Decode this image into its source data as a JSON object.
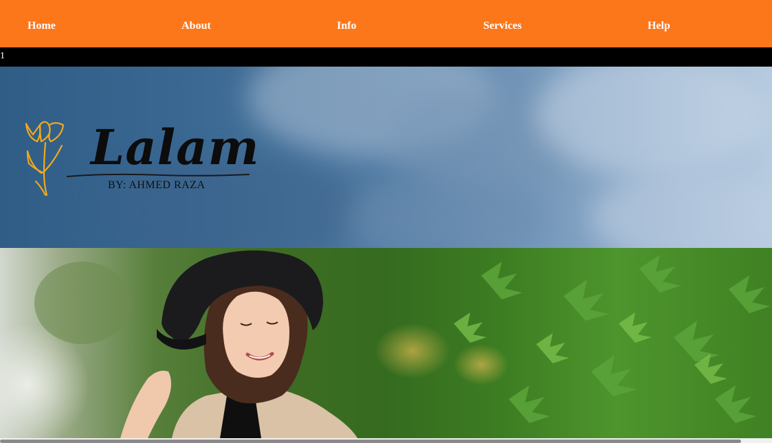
{
  "nav": {
    "items": [
      {
        "label": "Home"
      },
      {
        "label": "About"
      },
      {
        "label": "Info"
      },
      {
        "label": "Services"
      },
      {
        "label": "Help"
      }
    ]
  },
  "bar": {
    "text": "1"
  },
  "logo": {
    "script": "Lalam",
    "subtitle": "BY: AHMED RAZA"
  },
  "colors": {
    "nav_bg": "#fc761a",
    "bar_bg": "#000000",
    "logo_flower": "#f2a91b"
  },
  "icons": {
    "logo_flower": "tulip-icon"
  }
}
